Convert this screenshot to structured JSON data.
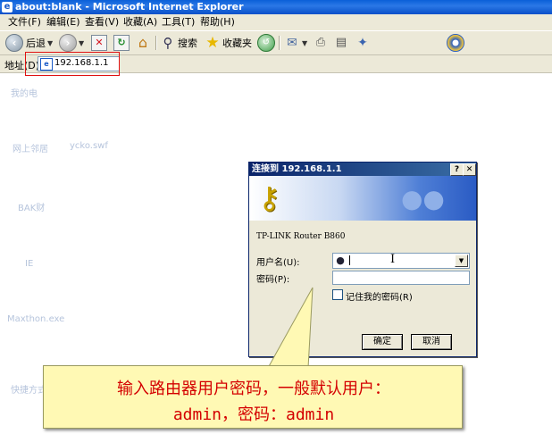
{
  "window": {
    "title": "about:blank - Microsoft Internet Explorer"
  },
  "menu": {
    "items": [
      "文件(F)",
      "编辑(E)",
      "查看(V)",
      "收藏(A)",
      "工具(T)",
      "帮助(H)"
    ]
  },
  "toolbar": {
    "back_label": "后退",
    "search_label": "搜索",
    "favorites_label": "收藏夹"
  },
  "address": {
    "label": "地址(D)",
    "value": "192.168.1.1"
  },
  "desktop": {
    "items": [
      "我的电",
      "网上邻居",
      "ycko.swf",
      "BAK财",
      "IE",
      "Maxthon.exe",
      "快捷方式"
    ]
  },
  "dialog": {
    "title": "连接到 192.168.1.1",
    "help_button": "?",
    "close_button": "✕",
    "realm": "TP-LINK Router B860",
    "username_label": "用户名(U):",
    "password_label": "密码(P):",
    "remember_label": "记住我的密码(R)",
    "ok_label": "确定",
    "cancel_label": "取消"
  },
  "callout": {
    "line1": "输入路由器用户密码，一般默认用户：",
    "line2": "admin，密码：admin"
  },
  "colors": {
    "highlight": "#e01010",
    "callout_bg": "#fff9b4",
    "callout_text": "#d40000"
  }
}
